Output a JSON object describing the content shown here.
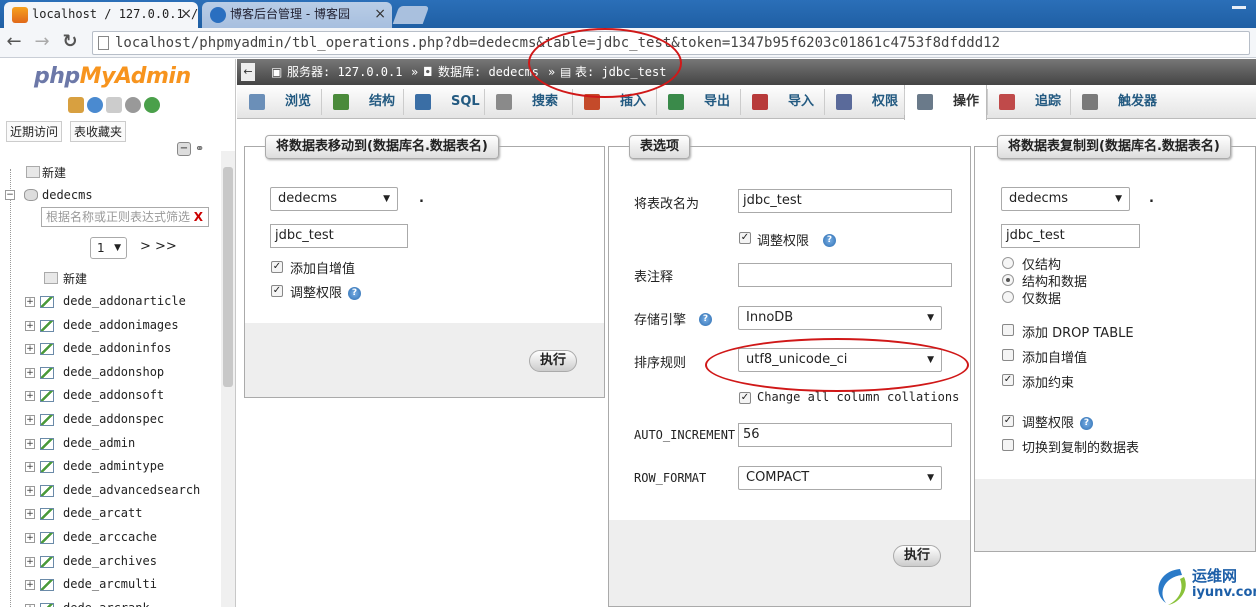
{
  "browser": {
    "tabs": [
      {
        "title": "localhost / 127.0.0.1 / "
      },
      {
        "title": "博客后台管理 - 博客园"
      }
    ],
    "tab_close": "×",
    "url": "localhost/phpmyadmin/tbl_operations.php?db=dedecms&table=jdbc_test&token=1347b95f6203c01861c4753f8dfddd12"
  },
  "sidebar": {
    "logo_php": "php",
    "logo_myadmin": "MyAdmin",
    "tabs": [
      "近期访问",
      "表收藏夹"
    ],
    "new_label": "新建",
    "db_name": "dedecms",
    "filter_placeholder": "根据名称或正则表达式筛选",
    "filter_clear": "X",
    "page_value": "1",
    "page_nav": "> >>",
    "table_new": "新建",
    "tables": [
      "dede_addonarticle",
      "dede_addonimages",
      "dede_addoninfos",
      "dede_addonshop",
      "dede_addonsoft",
      "dede_addonspec",
      "dede_admin",
      "dede_admintype",
      "dede_advancedsearch",
      "dede_arcatt",
      "dede_arccache",
      "dede_archives",
      "dede_arcmulti",
      "dede_arcrank"
    ]
  },
  "breadcrumb": {
    "back": "←",
    "server": "服务器: 127.0.0.1",
    "sep1": "»",
    "database": "数据库: dedecms",
    "sep2": "»",
    "table": "表: jdbc_test"
  },
  "menu": {
    "tabs": [
      {
        "label": "浏览",
        "icon": "browse-icon",
        "color": "#6b8fb8"
      },
      {
        "label": "结构",
        "icon": "structure-icon",
        "color": "#4a8a3a"
      },
      {
        "label": "SQL",
        "icon": "sql-icon",
        "color": "#3a6ea5"
      },
      {
        "label": "搜索",
        "icon": "search-icon",
        "color": "#8a8a8a"
      },
      {
        "label": "插入",
        "icon": "insert-icon",
        "color": "#c44a2a"
      },
      {
        "label": "导出",
        "icon": "export-icon",
        "color": "#3a8a4a"
      },
      {
        "label": "导入",
        "icon": "import-icon",
        "color": "#b83a3a"
      },
      {
        "label": "权限",
        "icon": "privileges-icon",
        "color": "#5a6a9a"
      },
      {
        "label": "操作",
        "icon": "wrench-icon",
        "color": "#6a7a8a"
      },
      {
        "label": "追踪",
        "icon": "eye-icon",
        "color": "#c04a4a"
      },
      {
        "label": "触发器",
        "icon": "triggers-icon",
        "color": "#7a7a7a"
      }
    ],
    "active": "操作"
  },
  "move_panel": {
    "legend": "将数据表移动到(数据库名.数据表名)",
    "db_select": "dedecms",
    "dot": ".",
    "table_name": "jdbc_test",
    "checkboxes": [
      {
        "label": "添加自增值",
        "checked": true
      },
      {
        "label": "调整权限",
        "checked": true
      }
    ],
    "go": "执行"
  },
  "options_panel": {
    "legend": "表选项",
    "rename_label": "将表改名为",
    "rename_value": "jdbc_test",
    "adjust_priv_label": "调整权限",
    "adjust_priv_checked": true,
    "comment_label": "表注释",
    "comment_value": "",
    "engine_label": "存储引擎",
    "engine_value": "InnoDB",
    "collation_label": "排序规则",
    "collation_value": "utf8_unicode_ci",
    "change_all_label": "Change all column collations",
    "change_all_checked": true,
    "auto_inc_label": "AUTO_INCREMENT",
    "auto_inc_value": "56",
    "row_format_label": "ROW_FORMAT",
    "row_format_value": "COMPACT",
    "go": "执行"
  },
  "copy_panel": {
    "legend": "将数据表复制到(数据库名.数据表名)",
    "db_select": "dedecms",
    "dot": ".",
    "table_name": "jdbc_test",
    "radios": [
      {
        "label": "仅结构",
        "checked": false
      },
      {
        "label": "结构和数据",
        "checked": true
      },
      {
        "label": "仅数据",
        "checked": false
      }
    ],
    "checkboxes": [
      {
        "label": "添加 DROP TABLE",
        "checked": false
      },
      {
        "label": "添加自增值",
        "checked": false
      },
      {
        "label": "添加约束",
        "checked": true
      },
      {
        "label": "调整权限",
        "checked": true
      },
      {
        "label": "切换到复制的数据表",
        "checked": false
      }
    ]
  },
  "watermark": {
    "text_top": "运维网",
    "text_bottom": "iyunv.com"
  }
}
